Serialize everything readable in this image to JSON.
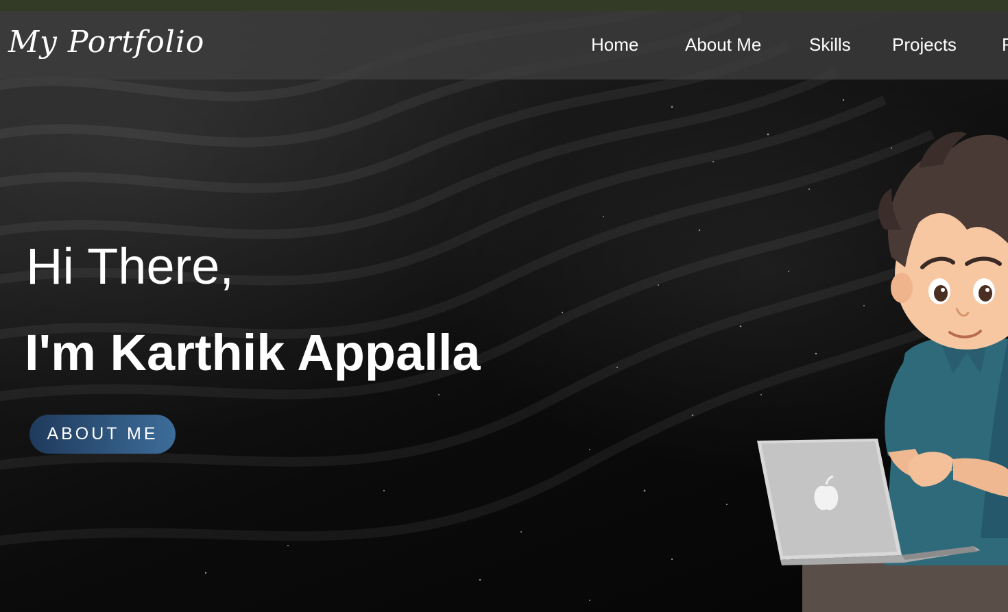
{
  "nav": {
    "logo": "My Portfolio",
    "items": [
      {
        "label": "Home"
      },
      {
        "label": "About Me"
      },
      {
        "label": "Skills"
      },
      {
        "label": "Projects"
      },
      {
        "label": "R"
      }
    ]
  },
  "hero": {
    "greeting": "Hi There,",
    "name": "I'm Karthik Appalla",
    "button_label": "ABOUT ME",
    "illustration": "boy-with-laptop-illustration"
  },
  "colors": {
    "top_strip": "#333a26",
    "navbar": "#3e3e3e",
    "button_start": "#1f3a5c",
    "button_end": "#3d6d9a",
    "text": "#ffffff"
  }
}
